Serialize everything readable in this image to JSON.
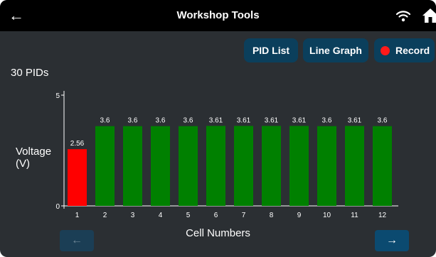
{
  "header": {
    "back_icon": "←",
    "title": "Workshop Tools",
    "wifi_icon": "wifi-icon",
    "home_icon": "home-icon"
  },
  "toolbar": {
    "pid_list_label": "PID List",
    "line_graph_label": "Line Graph",
    "record_label": "Record"
  },
  "pid_count": "30 PIDs",
  "nav": {
    "prev_icon": "←",
    "next_icon": "→"
  },
  "colors": {
    "bar_normal": "#008000",
    "bar_low": "#ff0000",
    "button_bg": "#0b3f5c",
    "record_dot": "#ff1a1a"
  },
  "chart_data": {
    "type": "bar",
    "xlabel": "Cell Numbers",
    "ylabel": "Voltage\n(V)",
    "ylim": [
      0,
      5
    ],
    "yticks": [
      "0",
      "5"
    ],
    "categories": [
      "1",
      "2",
      "3",
      "4",
      "5",
      "6",
      "7",
      "8",
      "9",
      "10",
      "11",
      "12"
    ],
    "values": [
      2.56,
      3.6,
      3.6,
      3.6,
      3.6,
      3.61,
      3.61,
      3.61,
      3.61,
      3.6,
      3.61,
      3.6
    ],
    "labels": [
      "2.56",
      "3.6",
      "3.6",
      "3.6",
      "3.6",
      "3.61",
      "3.61",
      "3.61",
      "3.61",
      "3.6",
      "3.61",
      "3.6"
    ],
    "bar_colors": [
      "#ff0000",
      "#008000",
      "#008000",
      "#008000",
      "#008000",
      "#008000",
      "#008000",
      "#008000",
      "#008000",
      "#008000",
      "#008000",
      "#008000"
    ],
    "grid": false
  }
}
